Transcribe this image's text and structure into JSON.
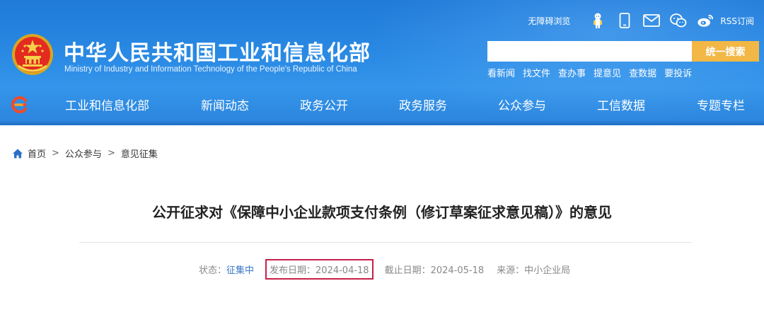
{
  "header": {
    "title_cn": "中华人民共和国工业和信息化部",
    "title_en": "Ministry of Industry and Information Technology of the People's Republic of China"
  },
  "utility": {
    "accessibility": "无障碍浏览",
    "rss": "RSS订阅",
    "icons": [
      "mascot-icon",
      "mobile-icon",
      "mail-icon",
      "wechat-icon",
      "weibo-icon"
    ]
  },
  "search": {
    "placeholder": "",
    "button_label": "统一搜索"
  },
  "quick_links": [
    "看新闻",
    "找文件",
    "查办事",
    "提意见",
    "查数据",
    "要投诉"
  ],
  "nav": {
    "items": [
      "工业和信息化部",
      "新闻动态",
      "政务公开",
      "政务服务",
      "公众参与",
      "工信数据",
      "专题专栏"
    ]
  },
  "breadcrumb": {
    "home": "首页",
    "sep": ">",
    "level1": "公众参与",
    "level2": "意见征集"
  },
  "article": {
    "title": "公开征求对《保障中小企业款项支付条例（修订草案征求意见稿）》的意见",
    "status_label": "状态：",
    "status_value": "征集中",
    "publish": "发布日期：2024-04-18",
    "deadline": "截止日期：2024-05-18",
    "source": "来源：中小企业局"
  },
  "colors": {
    "header_blue": "#2a8ae4",
    "search_button": "#f2b745",
    "highlight_box": "#c8204a",
    "status_link": "#3a78c8"
  }
}
